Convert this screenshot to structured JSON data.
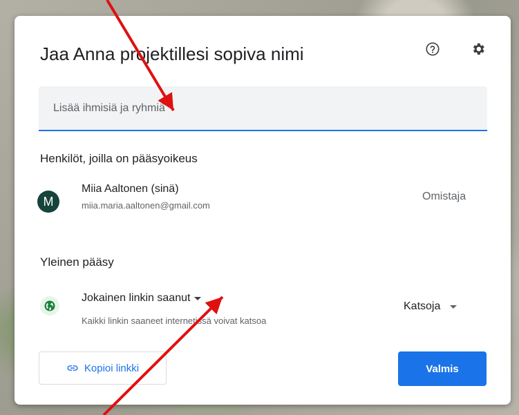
{
  "dialog": {
    "title": "Jaa Anna projektillesi sopiva nimi",
    "search_placeholder": "Lisää ihmisiä ja ryhmiä",
    "people_heading": "Henkilöt, joilla on pääsyoikeus",
    "person": {
      "avatar_letter": "M",
      "name": "Miia Aaltonen (sinä)",
      "email": "miia.maria.aaltonen@gmail.com",
      "role": "Omistaja"
    },
    "general_heading": "Yleinen pääsy",
    "general_access": {
      "label": "Jokainen linkin saanut",
      "description": "Kaikki linkin saaneet internetissä voivat katsoa",
      "role": "Katsoja"
    },
    "copy_link_label": "Kopioi linkki",
    "done_label": "Valmis"
  },
  "icons": {
    "help": "help-icon",
    "settings": "gear-icon",
    "globe": "globe-icon",
    "link": "link-icon",
    "dropdown": "chevron-down-icon"
  },
  "colors": {
    "accent": "#1a73e8",
    "avatar": "#16433b",
    "globe": "#188038",
    "annotation_arrow": "#e01010"
  }
}
